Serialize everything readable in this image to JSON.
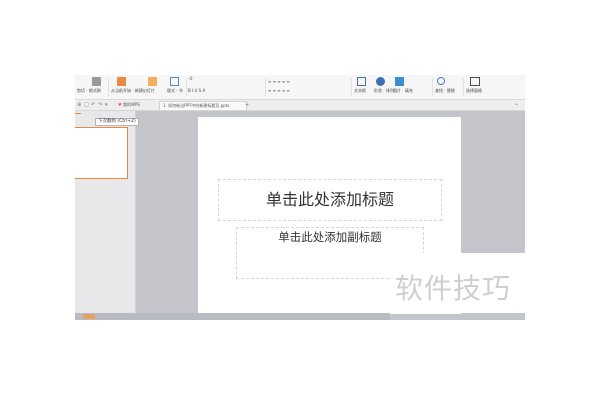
{
  "ribbon": {
    "groups": [
      {
        "name": "paste-group",
        "label": "剪切 · 格式刷",
        "color": "#8a8a8a"
      },
      {
        "name": "slide-start-group",
        "label": "从当前开始 · 新建幻灯片",
        "color": "#e07b2e"
      },
      {
        "name": "layout-group",
        "label": "版式 · 节",
        "color": "#6b86b5"
      },
      {
        "name": "font-group",
        "label": "B  I  U  S  A",
        "color": "#444444"
      },
      {
        "name": "paragraph-group",
        "label": "≡ ≡ ≡ ≡ ≡",
        "color": "#555555"
      },
      {
        "name": "textbox-group",
        "label": "文本框",
        "color": "#4a6fb0"
      },
      {
        "name": "shape-group",
        "label": "形状 · 排列",
        "color": "#3d6fb8"
      },
      {
        "name": "picture-group",
        "label": "图片 · 填充",
        "color": "#3b8fd0"
      },
      {
        "name": "find-group",
        "label": "查找 · 替换",
        "color": "#4a7cc0"
      },
      {
        "name": "select-pane-group",
        "label": "选择窗格",
        "color": "#4a4a4a"
      }
    ],
    "font_size_label": "-0"
  },
  "tabbar": {
    "quick_icons": [
      "⊕",
      "□",
      "↶",
      "↷",
      "▾"
    ],
    "tab_home": "我的WPS",
    "tab_doc": "1. 如何新出PPT中的新建标题页.pptx",
    "tab_add": "+"
  },
  "left_panel": {
    "tooltip": "下次翻到 (Ctrl+Z)"
  },
  "slide": {
    "title_placeholder": "单击此处添加标题",
    "subtitle_placeholder": "单击此处添加副标题"
  },
  "watermark": {
    "text": "软件技巧"
  }
}
